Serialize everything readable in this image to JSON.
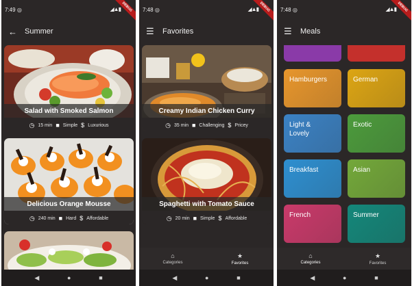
{
  "screen1": {
    "status": {
      "time": "7:49",
      "right": "◢▲▮"
    },
    "debug": "DEBUG",
    "appbar": {
      "back_icon": "arrow-left-icon",
      "title": "Summer"
    },
    "meals": [
      {
        "title": "Salad with Smoked Salmon",
        "duration": "15 min",
        "complexity": "Simple",
        "affordability": "Luxurious"
      },
      {
        "title": "Delicious Orange Mousse",
        "duration": "240 min",
        "complexity": "Hard",
        "affordability": "Affordable"
      }
    ]
  },
  "screen2": {
    "status": {
      "time": "7:48",
      "right": "◢▲▮"
    },
    "debug": "DEBUG",
    "appbar": {
      "menu_icon": "menu-icon",
      "title": "Favorites"
    },
    "meals": [
      {
        "title": "Creamy Indian Chicken Curry",
        "duration": "35 min",
        "complexity": "Challenging",
        "affordability": "Pricey"
      },
      {
        "title": "Spaghetti with Tomato Sauce",
        "duration": "20 min",
        "complexity": "Simple",
        "affordability": "Affordable"
      }
    ],
    "nav": {
      "categories": "Categories",
      "favorites": "Favorites"
    }
  },
  "screen3": {
    "status": {
      "time": "7:48",
      "right": "◢▲▮"
    },
    "debug": "DEBUG",
    "appbar": {
      "menu_icon": "menu-icon",
      "title": "Meals"
    },
    "categories": [
      {
        "label": "Hamburgers",
        "color": "#e7962c"
      },
      {
        "label": "German",
        "color": "#dca514"
      },
      {
        "label": "Light &\nLovely",
        "color": "#3b82c4"
      },
      {
        "label": "Exotic",
        "color": "#4c9b3c"
      },
      {
        "label": "Breakfast",
        "color": "#2e8fd0"
      },
      {
        "label": "Asian",
        "color": "#73a83a"
      },
      {
        "label": "French",
        "color": "#c93a6a"
      },
      {
        "label": "Summer",
        "color": "#14877a"
      }
    ],
    "nav": {
      "categories": "Categories",
      "favorites": "Favorites"
    }
  },
  "icons": {
    "clock": "clock-icon",
    "work": "briefcase-icon",
    "money": "dollar-icon",
    "home": "home-icon",
    "star": "star-icon"
  },
  "colors": {
    "background": "#2b2727",
    "card_overlay": "#282828"
  }
}
